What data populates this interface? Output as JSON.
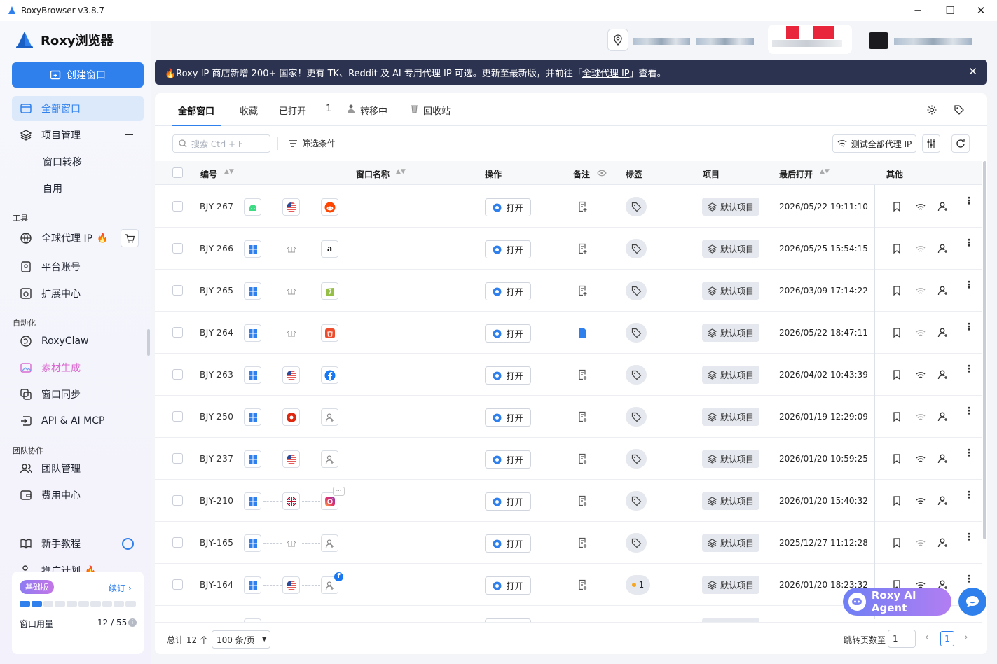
{
  "window": {
    "title": "RoxyBrowser v3.8.7",
    "min": "─",
    "max": "☐",
    "close": "✕"
  },
  "sidebar": {
    "brand": "Roxy浏览器",
    "create": "创建窗口",
    "items": {
      "all": "全部窗口",
      "project": "项目管理",
      "transfer": "窗口转移",
      "self": "自用",
      "proxy": "全球代理 IP",
      "platform": "平台账号",
      "ext": "扩展中心",
      "claw": "RoxyClaw",
      "material": "素材生成",
      "sync": "窗口同步",
      "api": "API & AI MCP",
      "team": "团队管理",
      "fee": "费用中心",
      "tutorial": "新手教程",
      "promo": "推广计划"
    },
    "sections": {
      "tools": "工具",
      "auto": "自动化",
      "team": "团队协作"
    },
    "usage": {
      "plan": "基础版",
      "renew": "续订 ›",
      "label": "窗口用量",
      "value": "12 / 55",
      "used_fraction": 0.22
    }
  },
  "banner": {
    "pre": "🔥Roxy IP 商店新增 200+ 国家！更有 TK、Reddit 及 AI 专用代理 IP 可选。更新至最新版，并前往「",
    "link": "全球代理 IP",
    "post": "」查看。"
  },
  "tabs": {
    "all": "全部窗口",
    "fav": "收藏",
    "opened": "已打开",
    "count": "1",
    "moving": "转移中",
    "bin": "回收站"
  },
  "toolbar": {
    "search_placeholder": "搜索 Ctrl + F",
    "filter": "筛选条件",
    "test": "测试全部代理 IP"
  },
  "columns": {
    "code": "编号",
    "name": "窗口名称",
    "op": "操作",
    "note": "备注",
    "tag": "标签",
    "project": "项目",
    "last": "最后打开",
    "other": "其他"
  },
  "rows": [
    {
      "code": "BJY-267",
      "os": "android",
      "region": "us",
      "site": "reddit",
      "tag": "",
      "project": "默认项目",
      "last": "2026/05/22 19:11:10",
      "note": "plain"
    },
    {
      "code": "BJY-266",
      "os": "windows",
      "region": "none",
      "site": "amazon",
      "tag": "",
      "project": "默认项目",
      "last": "2026/05/25 15:54:15",
      "note": "plain"
    },
    {
      "code": "BJY-265",
      "os": "windows",
      "region": "none",
      "site": "shopify",
      "tag": "",
      "project": "默认项目",
      "last": "2026/03/09 17:14:22",
      "note": "plain"
    },
    {
      "code": "BJY-264",
      "os": "windows",
      "region": "none",
      "site": "shop",
      "tag": "",
      "project": "默认项目",
      "last": "2026/05/22 18:47:11",
      "note": "filled"
    },
    {
      "code": "BJY-263",
      "os": "windows",
      "region": "us",
      "site": "facebook",
      "tag": "",
      "project": "默认项目",
      "last": "2026/04/02 10:43:39",
      "note": "plain"
    },
    {
      "code": "BJY-250",
      "os": "windows",
      "region": "hk",
      "site": "account",
      "tag": "",
      "project": "默认项目",
      "last": "2026/01/19 12:29:09",
      "note": "plain"
    },
    {
      "code": "BJY-237",
      "os": "windows",
      "region": "us",
      "site": "account",
      "tag": "",
      "project": "默认项目",
      "last": "2026/01/20 10:59:25",
      "note": "plain"
    },
    {
      "code": "BJY-210",
      "os": "windows",
      "region": "uk",
      "site": "instagram",
      "tag": "",
      "project": "默认项目",
      "last": "2026/01/20 15:40:32",
      "note": "plain"
    },
    {
      "code": "BJY-165",
      "os": "windows",
      "region": "none",
      "site": "account",
      "tag": "",
      "project": "默认项目",
      "last": "2025/12/27 11:12:28",
      "note": "plain"
    },
    {
      "code": "BJY-164",
      "os": "windows",
      "region": "us",
      "site": "account-fb",
      "tag": "1",
      "project": "默认项目",
      "last": "2026/01/20 18:23:32",
      "note": "plain"
    }
  ],
  "open_label": "打开",
  "footer": {
    "total": "总计 12 个",
    "per_page": "100 条/页",
    "jump": "跳转页数至",
    "jump_value": "1",
    "page": "1"
  },
  "agent": "Roxy AI Agent",
  "colors": {
    "accent": "#2f80ed",
    "banner": "#2c3350"
  }
}
